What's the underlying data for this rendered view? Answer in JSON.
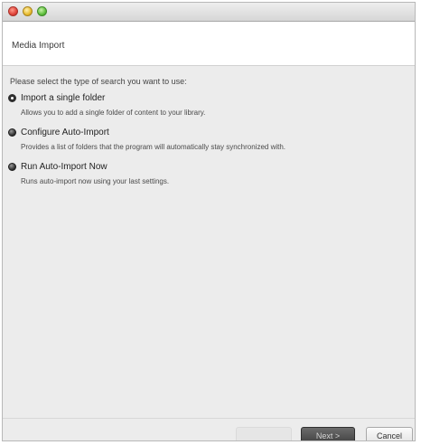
{
  "window": {
    "header_title": "Media Import"
  },
  "wizard": {
    "prompt": "Please select the type of search you want to use:",
    "options": [
      {
        "label": "Import a single folder",
        "description": "Allows you to add a single folder of content to your library.",
        "selected": true
      },
      {
        "label": "Configure Auto-Import",
        "description": "Provides a list of folders that the program will automatically stay synchronized with.",
        "selected": false
      },
      {
        "label": "Run Auto-Import Now",
        "description": "Runs auto-import now using your last settings.",
        "selected": false
      }
    ]
  },
  "footer": {
    "back_label": "",
    "next_label": "Next >",
    "cancel_label": "Cancel"
  }
}
